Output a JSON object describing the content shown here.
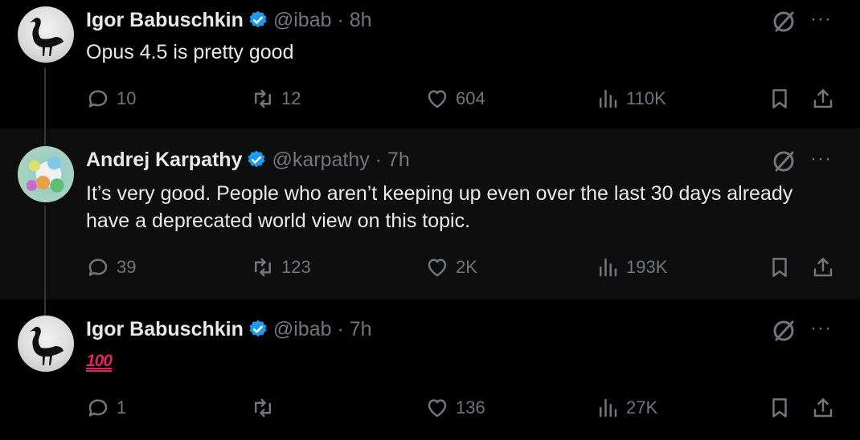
{
  "colors": {
    "background": "#000000",
    "highlight_row": "#0e0e0e",
    "text": "#e7e9ea",
    "muted": "#71767b",
    "verified": "#1d9bf0",
    "emoji_red": "#e0245e"
  },
  "tweets": [
    {
      "author": "Igor Babuschkin",
      "handle": "@ibab · 8h",
      "avatar": "goose-avatar",
      "text": "Opus 4.5 is pretty good",
      "replies": "10",
      "retweets": "12",
      "likes": "604",
      "views": "110K"
    },
    {
      "author": "Andrej Karpathy",
      "handle": "@karpathy · 7h",
      "avatar": "painting-avatar",
      "text": "It’s very good. People who aren’t keeping up even over the last 30 days already have a deprecated world view on this topic.",
      "replies": "39",
      "retweets": "123",
      "likes": "2K",
      "views": "193K"
    },
    {
      "author": "Igor Babuschkin",
      "handle": "@ibab · 7h",
      "avatar": "goose-avatar",
      "text": "100",
      "replies": "1",
      "retweets": "",
      "likes": "136",
      "views": "27K"
    }
  ],
  "menu": {
    "more": "···"
  },
  "icons": [
    "grok-icon",
    "more-icon",
    "reply-icon",
    "retweet-icon",
    "like-icon",
    "views-icon",
    "bookmark-icon",
    "share-icon",
    "verified-badge-icon"
  ]
}
